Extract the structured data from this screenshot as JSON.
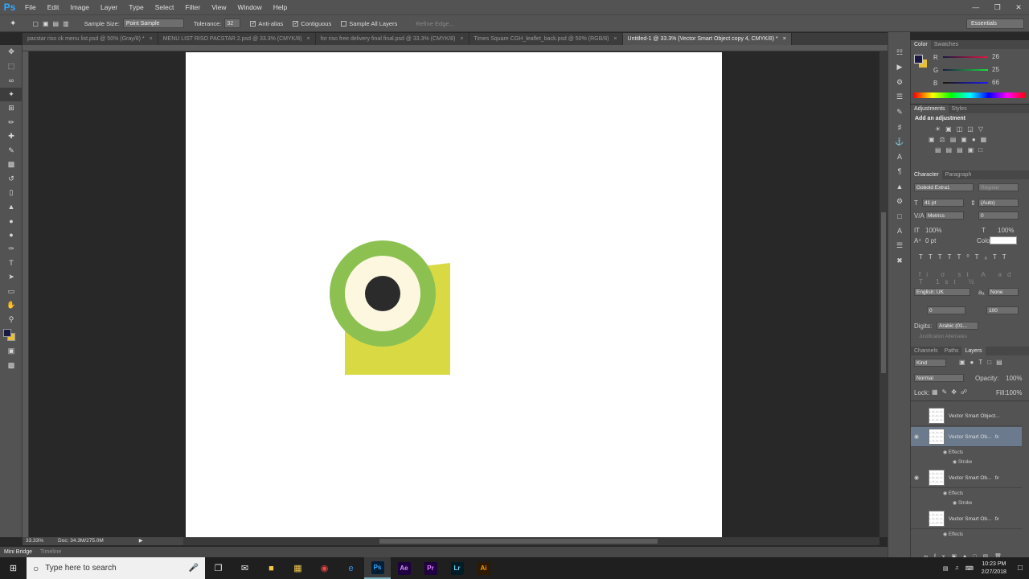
{
  "app": {
    "logo": "Ps"
  },
  "menus": [
    "File",
    "Edit",
    "Image",
    "Layer",
    "Type",
    "Select",
    "Filter",
    "View",
    "Window",
    "Help"
  ],
  "options": {
    "sample_size_label": "Sample Size:",
    "sample_size_value": "Point Sample",
    "tolerance_label": "Tolerance:",
    "tolerance_value": "32",
    "anti_alias": "Anti-alias",
    "contiguous": "Contiguous",
    "sample_all": "Sample All Layers",
    "refine": "Refine Edge...",
    "workspace": "Essentials"
  },
  "tabs": [
    "pacstar riso ck menu list.psd @ 50% (Gray/8) *",
    "MENU LIST RISO PACSTAR 2.psd @ 33.3% (CMYK/8)",
    "for riso free delivery final final.psd @ 33.3% (CMYK/8)",
    "Times Square CGH_leaflet_back.psd @ 50% (RGB/8)",
    "Untitled-1 @ 33.3% (Vector Smart Object copy 4, CMYK/8) *"
  ],
  "status": {
    "zoom": "33.33%",
    "doc": "Doc: 34.3M/275.0M"
  },
  "bottom_tabs": [
    "Mini Bridge",
    "Timeline"
  ],
  "color_panel": {
    "tabs": [
      "Color",
      "Swatches"
    ],
    "r_label": "R",
    "r": "26",
    "g_label": "G",
    "g": "25",
    "b_label": "B",
    "b": "66",
    "fg": "#1a1942",
    "bg": "#e8c03a"
  },
  "adjust_panel": {
    "tabs": [
      "Adjustments",
      "Styles"
    ],
    "hint": "Add an adjustment"
  },
  "char_panel": {
    "tabs": [
      "Character",
      "Paragraph"
    ],
    "font": "Gobold Extra1",
    "style": "Regular",
    "size": "41 pt",
    "leading": "(Auto)",
    "kerning": "Metrics",
    "tracking": "0",
    "vscale": "100%",
    "hscale": "100%",
    "baseline": "0 pt",
    "color_label": "Color:",
    "lang": "English: UK",
    "aa": "None",
    "v1": "0",
    "v2": "100",
    "digits_label": "Digits:",
    "digits": "Arabic (01...",
    "justif": "Justification Alternates"
  },
  "layers_panel": {
    "tabs": [
      "Channels",
      "Paths",
      "Layers"
    ],
    "kind": "Kind",
    "blend": "Normal",
    "opacity_label": "Opacity:",
    "opacity": "100%",
    "lock_label": "Lock:",
    "fill_label": "Fill:",
    "fill": "100%",
    "layers": [
      {
        "name": "Vector Smart Object...",
        "fx": ""
      },
      {
        "name": "Vector Smart Ob...",
        "fx": "fx"
      },
      {
        "name": "Vector Smart Ob...",
        "fx": "fx"
      },
      {
        "name": "Vector Smart Ob...",
        "fx": "fx"
      }
    ],
    "effects_label": "Effects",
    "stroke_label": "Stroke"
  },
  "taskbar": {
    "search_placeholder": "Type here to search",
    "time": "10:23 PM",
    "date": "2/27/2018",
    "apps": [
      "Ps",
      "Ae",
      "Pr",
      "Lr",
      "Ai"
    ]
  }
}
